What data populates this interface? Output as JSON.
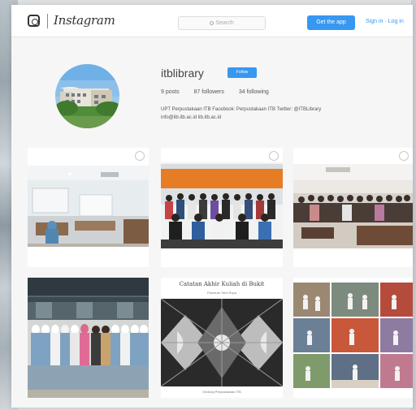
{
  "header": {
    "wordmark": "Instagram",
    "search_placeholder": "Search",
    "get_app_label": "Get the app",
    "sign_in_label": "Sign in",
    "log_in_label": "Log in",
    "separator": "·"
  },
  "profile": {
    "username": "itblibrary",
    "follow_label": "Follow",
    "stats": {
      "posts": "9 posts",
      "followers": "87 followers",
      "following": "34 following"
    },
    "bio_line1": "UPT Perpustakaan ITB Facebook: Perpustakaan ITB Twitter: @ITBLibrary",
    "bio_line2": "info@lib.itb.ac.id lib.itb.ac.id"
  },
  "posts": [
    {
      "id": "classroom"
    },
    {
      "id": "group-orange-wall"
    },
    {
      "id": "seminar-room"
    },
    {
      "id": "group-outdoor"
    },
    {
      "id": "poster",
      "title": "Catatan Akhir Kuliah di Bukit",
      "subtitle": "Pameran Seni Rupa",
      "footer": "Gedung Perpustakaan ITB"
    },
    {
      "id": "sports-collage"
    }
  ],
  "colors": {
    "accent": "#3897f0",
    "page_bg": "#f6f6f6",
    "text": "#444444"
  }
}
